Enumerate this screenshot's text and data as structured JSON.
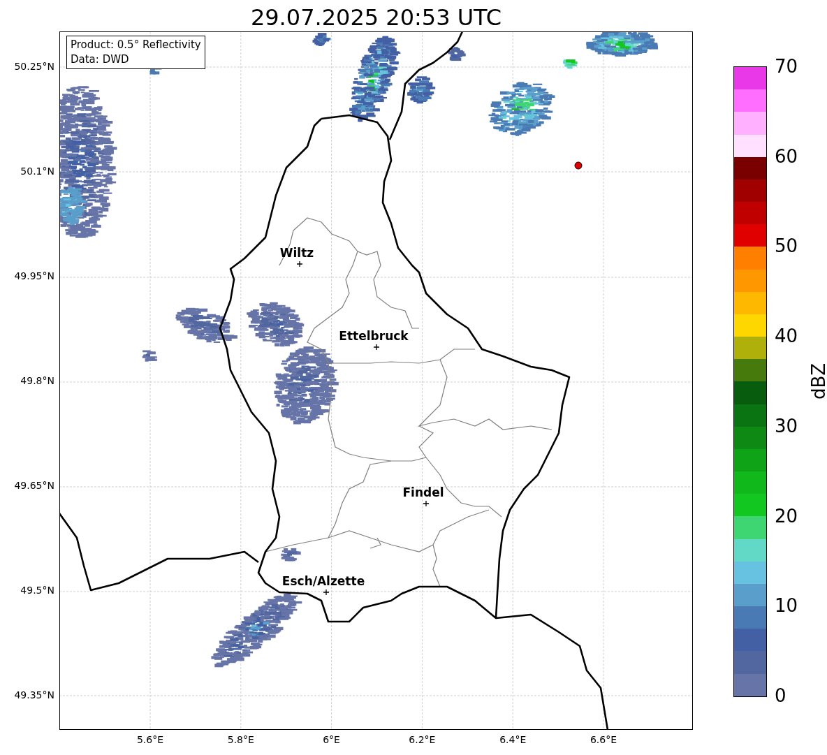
{
  "title": "29.07.2025 20:53 UTC",
  "info_box": {
    "lines": [
      "Product: 0.5° Reflectivity",
      "Data: DWD"
    ]
  },
  "map": {
    "y_ticks": [
      "50.25°N",
      "50.1°N",
      "49.95°N",
      "49.8°N",
      "49.65°N",
      "49.5°N",
      "49.35°N"
    ],
    "x_ticks": [
      "5.6°E",
      "5.8°E",
      "6°E",
      "6.2°E",
      "6.4°E",
      "6.6°E"
    ],
    "cities": [
      {
        "name": "Wiltz"
      },
      {
        "name": "Ettelbruck"
      },
      {
        "name": "Findel"
      },
      {
        "name": "Esch/Alzette"
      }
    ]
  },
  "colorbar": {
    "label": "dBZ",
    "ticks": [
      "70",
      "60",
      "50",
      "40",
      "30",
      "20",
      "10",
      "0"
    ],
    "bins": [
      {
        "color": "#e838e8"
      },
      {
        "color": "#ff6eff"
      },
      {
        "color": "#ffb0ff"
      },
      {
        "color": "#ffe0ff"
      },
      {
        "color": "#7a0000"
      },
      {
        "color": "#a00000"
      },
      {
        "color": "#c00000"
      },
      {
        "color": "#e00000"
      },
      {
        "color": "#ff7f00"
      },
      {
        "color": "#ff9800"
      },
      {
        "color": "#ffb800"
      },
      {
        "color": "#ffd700"
      },
      {
        "color": "#b0b00a"
      },
      {
        "color": "#467a0d"
      },
      {
        "color": "#075c0e"
      },
      {
        "color": "#0a7412"
      },
      {
        "color": "#0e8a14"
      },
      {
        "color": "#0fa318"
      },
      {
        "color": "#10b81c"
      },
      {
        "color": "#12c820"
      },
      {
        "color": "#3ed672"
      },
      {
        "color": "#62d8c6"
      },
      {
        "color": "#66c2e0"
      },
      {
        "color": "#5a9ecb"
      },
      {
        "color": "#4a7ab4"
      },
      {
        "color": "#4460a4"
      },
      {
        "color": "#52679f"
      },
      {
        "color": "#6674a8"
      }
    ]
  }
}
